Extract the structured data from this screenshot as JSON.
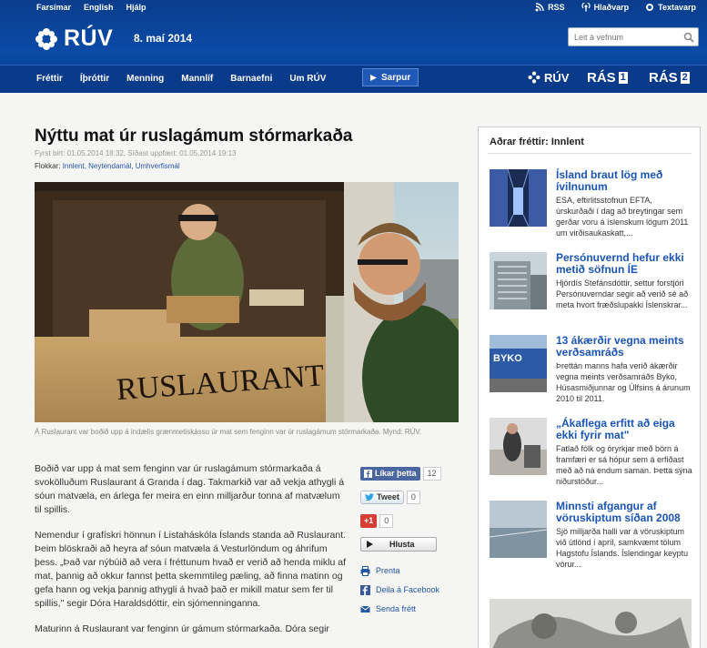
{
  "topbar": {
    "links": [
      "Farsímar",
      "English",
      "Hjálp"
    ],
    "right": [
      "RSS",
      "Hlaðvarp",
      "Textavarp"
    ]
  },
  "logo": {
    "text": "RÚV"
  },
  "date": "8. maí 2014",
  "search": {
    "placeholder": "Leit á vefnum"
  },
  "nav": {
    "items": [
      "Fréttir",
      "Íþróttir",
      "Menning",
      "Mannlíf",
      "Barnaefni",
      "Um RÚV"
    ],
    "sarpur": "Sarpur",
    "channels": {
      "ruv": "RÚV",
      "ras1_word": "RÁS",
      "ras1_num": "1",
      "ras2_word": "RÁS",
      "ras2_num": "2"
    }
  },
  "article": {
    "title": "Nýttu mat úr ruslagámum stórmarkaða",
    "meta": "Fyrst birt: 01.05.2014 18:32, Síðast uppfært: 01.05.2014 19:13",
    "cats_label": "Flokkar:",
    "cats": "Innlent, Neytendamál, Umhverfismál",
    "photo_sign": "RUSLAURANT",
    "caption": "Á Ruslaurant var boðið upp á indælis grænmetiskássu úr mat sem fenginn var úr ruslagámum stórmarkaða. Mynd: RÚV.",
    "p1": "Boðið var upp á mat sem fenginn var úr ruslagámum stórmarkaða á svokölluðum Ruslaurant á Granda í dag. Takmarkið var að vekja athygli á sóun matvæla, en árlega fer meira en einn milljarður tonna af matvælum til spillis.",
    "p2": "Nemendur í grafískri hönnun í Listaháskóla Íslands standa að Ruslaurant. Þeim blöskraði að heyra af sóun matvæla á Vesturlöndum og áhrifum þess. „Það var nýbúið að vera í fréttunum hvað er verið að henda miklu af mat, þannig að okkur fannst þetta skemmtileg pæling, að finna matinn og gefa hann og vekja þannig athygli á hvað það er mikill matur sem fer til spillis,\" segir Dóra Haraldsdóttir, ein sjómenninganna.",
    "p3": "Maturinn á Ruslaurant var fenginn úr gámum stórmarkaða. Dóra segir"
  },
  "share": {
    "fb_label": "Líkar þetta",
    "fb_count": "12",
    "tw_label": "Tweet",
    "tw_count": "0",
    "gp_label": "+1",
    "gp_count": "0",
    "listen": "Hlusta",
    "print": "Prenta",
    "facebook": "Deila á Facebook",
    "send": "Senda frétt"
  },
  "sidebar": {
    "title": "Aðrar fréttir: Innlent",
    "items": [
      {
        "headline": "Ísland braut lög með ívilnunum",
        "desc": "ESA, eftirlitsstofnun EFTA, úrskurðaði í dag að breytingar sem gerðar voru á íslenskum lögum 2011 um virðisaukaskatt,..."
      },
      {
        "headline": "Persónuvernd hefur ekki metið söfnun ÍE",
        "desc": "Hjördís Stefánsdóttir, settur forstjóri Persónuverndar segir að verið sé að meta hvort fræðslupakki Íslenskrar..."
      },
      {
        "headline": "13 ákærðir vegna meints verðsamráðs",
        "desc": "Þrettán manns hafa verið ákærðir vegna meints verðsamráðs Byko, Húsasmiðjunnar og Úlfsins á árunum 2010 til 2011."
      },
      {
        "headline": "„Ákaflega erfitt að eiga ekki fyrir mat\"",
        "desc": "Fatlað fólk og öryrkjar með börn á framfæri er sá hópur sem á erfiðast með að ná endum saman. Þetta sýna niðurstöður..."
      },
      {
        "headline": "Minnsti afgangur af vöruskiptum síðan 2008",
        "desc": "Sjö milljarða halli var á vöruskiptum við útlönd í apríl, samkvæmt tölum Hagstofu Íslands. Íslendingar keyptu vörur..."
      }
    ],
    "byko_sign": "BYKO"
  }
}
